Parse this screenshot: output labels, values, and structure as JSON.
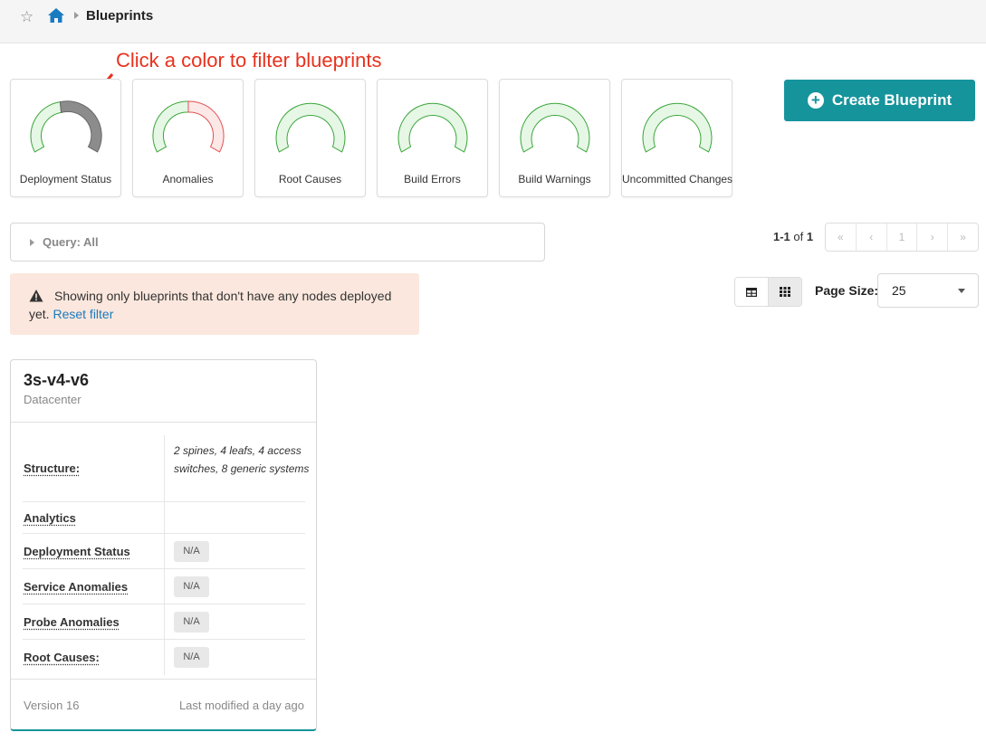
{
  "header": {
    "title": "Blueprints",
    "favorite_icon": "star-outline-icon",
    "home_icon": "home-icon",
    "home_color": "#1a7bc0"
  },
  "annotation": {
    "text": "Click a color to filter blueprints",
    "color": "#e8321e"
  },
  "gauges": [
    {
      "label": "Deployment Status",
      "state": "partial-gray"
    },
    {
      "label": "Anomalies",
      "state": "partial-red"
    },
    {
      "label": "Root Causes",
      "state": "green"
    },
    {
      "label": "Build Errors",
      "state": "green"
    },
    {
      "label": "Build Warnings",
      "state": "green"
    },
    {
      "label": "Uncommitted Changes",
      "state": "green"
    }
  ],
  "create_button": {
    "label": "Create Blueprint",
    "color": "#16949c"
  },
  "query": {
    "label": "Query: All"
  },
  "pagination": {
    "range": "1-1",
    "of_label": "of",
    "total": "1",
    "first": "«",
    "prev": "‹",
    "current": "1",
    "next": "›",
    "last": "»"
  },
  "alert": {
    "text": "Showing only blueprints that don't have any nodes deployed yet.",
    "link": "Reset filter",
    "icon": "warning-icon"
  },
  "view_toggle": {
    "options": [
      "table-view",
      "card-view"
    ],
    "selected": "card-view"
  },
  "page_size": {
    "label": "Page Size:",
    "value": "25"
  },
  "blueprint": {
    "name": "3s-v4-v6",
    "type": "Datacenter",
    "rows": [
      {
        "key": "Structure:",
        "value": "2 spines, 4 leafs, 4 access switches, 8 generic systems"
      },
      {
        "key": "Analytics",
        "value": ""
      },
      {
        "key": "Deployment Status",
        "value": "N/A"
      },
      {
        "key": "Service Anomalies",
        "value": "N/A"
      },
      {
        "key": "Probe Anomalies",
        "value": "N/A"
      },
      {
        "key": "Root Causes:",
        "value": "N/A"
      }
    ],
    "version": "Version 16",
    "modified": "Last modified a day ago"
  }
}
